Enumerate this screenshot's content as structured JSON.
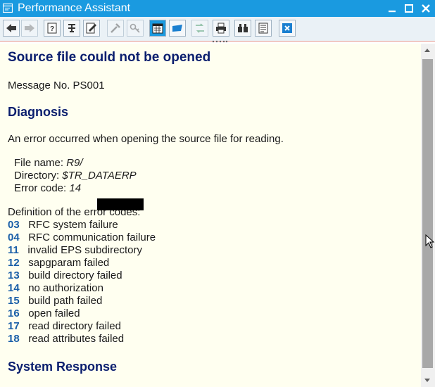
{
  "window": {
    "title": "Performance Assistant"
  },
  "colors": {
    "titlebar": "#1a9ae0",
    "heading": "#0a1e6e",
    "code": "#1a5fa8",
    "background": "#fffff0"
  },
  "toolbar": {
    "buttons": [
      {
        "name": "back-icon"
      },
      {
        "name": "forward-icon"
      },
      {
        "name": "help-icon"
      },
      {
        "name": "technical-info-icon"
      },
      {
        "name": "edit-icon"
      },
      {
        "name": "tools-icon"
      },
      {
        "name": "key-icon"
      },
      {
        "name": "calendar-icon"
      },
      {
        "name": "flag-icon"
      },
      {
        "name": "transfer-icon"
      },
      {
        "name": "print-icon"
      },
      {
        "name": "binoculars-icon"
      },
      {
        "name": "document-icon"
      },
      {
        "name": "close-icon"
      }
    ]
  },
  "message": {
    "title": "Source file could not be opened",
    "number_line": "Message No. PS001",
    "diagnosis_heading": "Diagnosis",
    "diagnosis_text": "An error occurred when opening the source file for reading.",
    "file_name_label": "File name:",
    "file_name_value": "R9/",
    "directory_label": "Directory:",
    "directory_value": "$TR_DATAERP",
    "error_code_label": "Error code:",
    "error_code_value": "14",
    "codes_intro": "Definition of the error codes:",
    "codes": [
      {
        "code": "03",
        "text": "RFC system failure"
      },
      {
        "code": "04",
        "text": "RFC communication failure"
      },
      {
        "code": "11",
        "text": "invalid EPS subdirectory"
      },
      {
        "code": "12",
        "text": "sapgparam failed"
      },
      {
        "code": "13",
        "text": "build directory failed"
      },
      {
        "code": "14",
        "text": "no authorization"
      },
      {
        "code": "15",
        "text": "build path failed"
      },
      {
        "code": "16",
        "text": "open failed"
      },
      {
        "code": "17",
        "text": "read directory failed"
      },
      {
        "code": "18",
        "text": "read attributes failed"
      }
    ],
    "system_response_heading": "System Response"
  }
}
